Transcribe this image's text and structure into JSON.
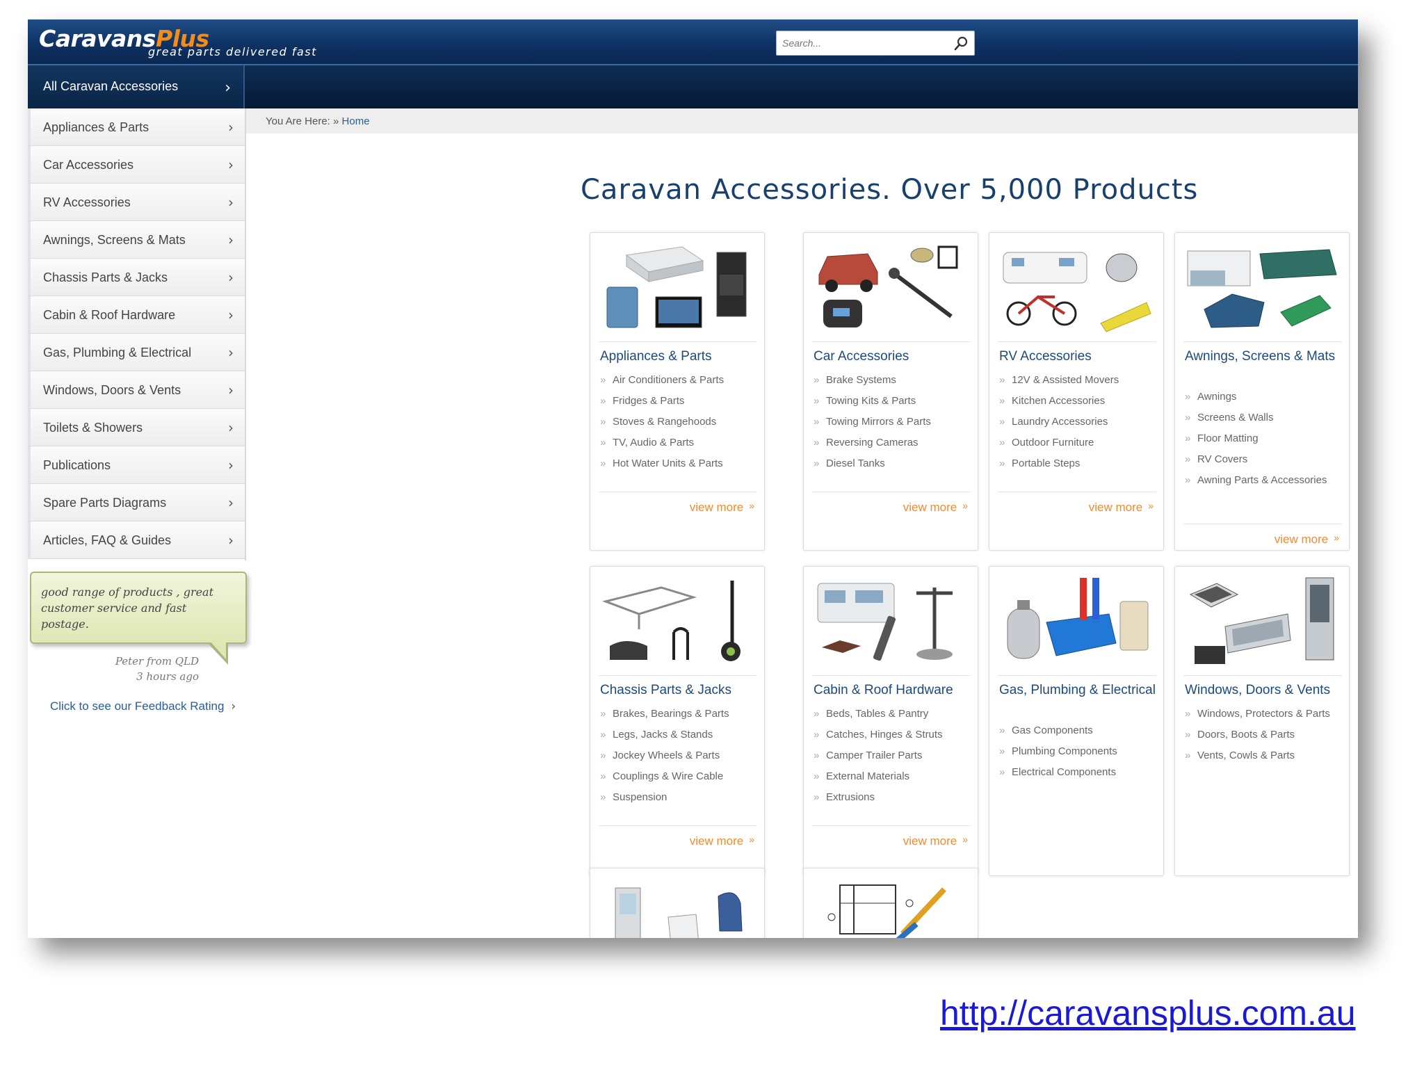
{
  "header": {
    "logo_main": "Caravans",
    "logo_plus": "Plus",
    "tagline": "great parts delivered fast",
    "search_placeholder": "Search..."
  },
  "nav": {
    "all_label": "All Caravan Accessories"
  },
  "sidebar": {
    "items": [
      {
        "label": "Appliances & Parts"
      },
      {
        "label": "Car Accessories"
      },
      {
        "label": "RV Accessories"
      },
      {
        "label": "Awnings, Screens & Mats"
      },
      {
        "label": "Chassis Parts & Jacks"
      },
      {
        "label": "Cabin & Roof Hardware"
      },
      {
        "label": "Gas, Plumbing & Electrical"
      },
      {
        "label": "Windows, Doors & Vents"
      },
      {
        "label": "Toilets & Showers"
      },
      {
        "label": "Publications"
      },
      {
        "label": "Spare Parts Diagrams"
      },
      {
        "label": "Articles, FAQ & Guides"
      }
    ]
  },
  "testimonial": {
    "quote": "good range of products , great customer service and fast postage.",
    "author": "Peter from QLD",
    "time": "3 hours ago",
    "feedback_link": "Click to see our Feedback Rating"
  },
  "breadcrumb": {
    "prefix": "You Are Here: »",
    "home": "Home"
  },
  "main": {
    "title": "Caravan Accessories. Over 5,000 Products",
    "view_more": "view more",
    "cards": [
      {
        "title": "Appliances & Parts",
        "links": [
          "Air Conditioners & Parts",
          "Fridges & Parts",
          "Stoves & Rangehoods",
          "TV, Audio & Parts",
          "Hot Water Units & Parts"
        ]
      },
      {
        "title": "Car Accessories",
        "links": [
          "Brake Systems",
          "Towing Kits & Parts",
          "Towing Mirrors & Parts",
          "Reversing Cameras",
          "Diesel Tanks"
        ]
      },
      {
        "title": "RV Accessories",
        "links": [
          "12V & Assisted Movers",
          "Kitchen Accessories",
          "Laundry Accessories",
          "Outdoor Furniture",
          "Portable Steps"
        ]
      },
      {
        "title": "Awnings, Screens & Mats",
        "links": [
          "Awnings",
          "Screens & Walls",
          "Floor Matting",
          "RV Covers",
          "Awning Parts & Accessories"
        ]
      },
      {
        "title": "Chassis Parts & Jacks",
        "links": [
          "Brakes, Bearings & Parts",
          "Legs, Jacks & Stands",
          "Jockey Wheels & Parts",
          "Couplings & Wire Cable",
          "Suspension"
        ]
      },
      {
        "title": "Cabin & Roof Hardware",
        "links": [
          "Beds, Tables & Pantry",
          "Catches, Hinges & Struts",
          "Camper Trailer Parts",
          "External Materials",
          "Extrusions"
        ]
      },
      {
        "title": "Gas, Plumbing & Electrical",
        "links": [
          "Gas Components",
          "Plumbing Components",
          "Electrical Components"
        ]
      },
      {
        "title": "Windows, Doors & Vents",
        "links": [
          "Windows, Protectors & Parts",
          "Doors, Boots & Parts",
          "Vents, Cowls & Parts"
        ]
      }
    ]
  },
  "footer": {
    "url": "http://caravansplus.com.au"
  },
  "colors": {
    "header_blue": "#0f3264",
    "accent_orange": "#f08a33",
    "link_blue": "#1d4a7a"
  }
}
